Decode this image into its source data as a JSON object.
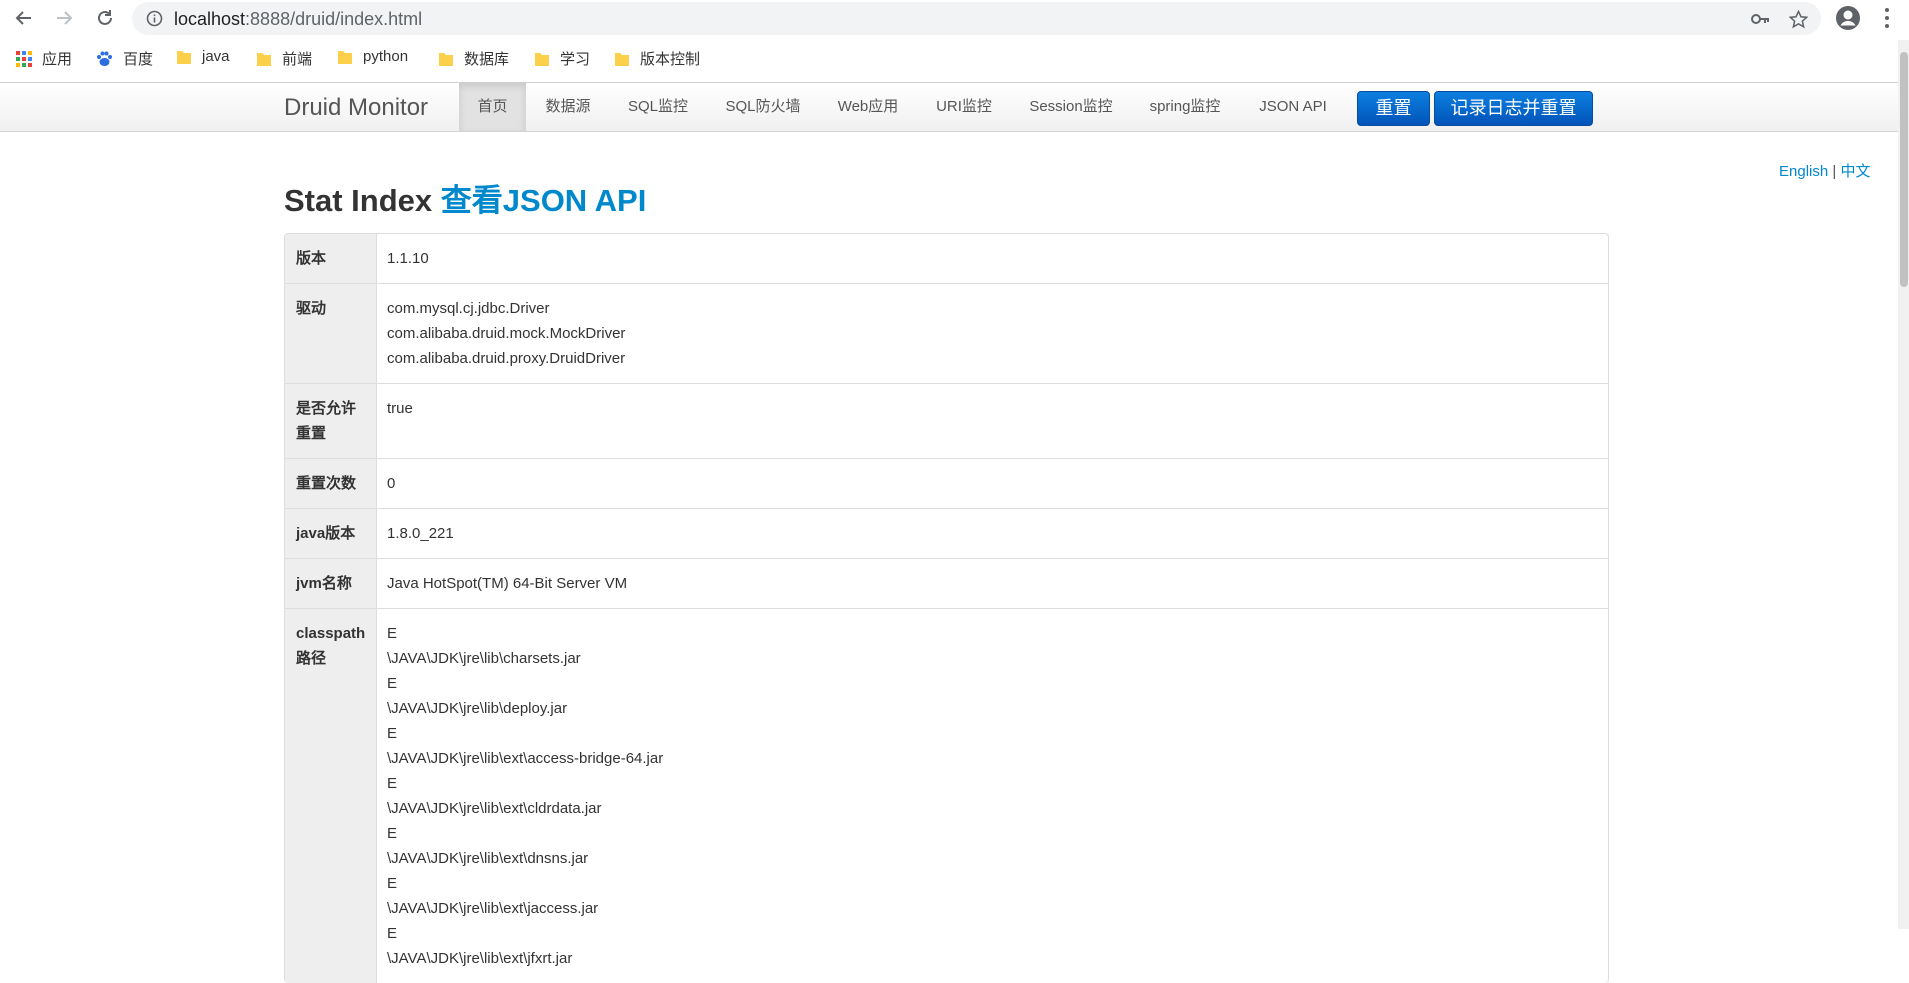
{
  "browser": {
    "url_host": "localhost",
    "url_rest": ":8888/druid/index.html",
    "bookmarks": [
      {
        "label": "应用",
        "icon": "apps-grid-icon"
      },
      {
        "label": "百度",
        "icon": "baidu-paw-icon"
      },
      {
        "label": "java",
        "icon": "folder-icon"
      },
      {
        "label": "前端",
        "icon": "folder-icon"
      },
      {
        "label": "python",
        "icon": "folder-icon"
      },
      {
        "label": "数据库",
        "icon": "folder-icon"
      },
      {
        "label": "学习",
        "icon": "folder-icon"
      },
      {
        "label": "版本控制",
        "icon": "folder-icon"
      }
    ]
  },
  "navbar": {
    "brand": "Druid Monitor",
    "items": [
      "首页",
      "数据源",
      "SQL监控",
      "SQL防火墙",
      "Web应用",
      "URI监控",
      "Session监控",
      "spring监控",
      "JSON API"
    ],
    "active_index": 0,
    "reset_button": "重置",
    "log_reset_button": "记录日志并重置",
    "button_color": "#0461c8"
  },
  "lang": {
    "english": "English",
    "separator": "|",
    "chinese": "中文"
  },
  "page": {
    "title": "Stat Index",
    "title_link": "查看JSON API",
    "link_color": "#0088cc"
  },
  "stats": [
    {
      "label": "版本",
      "values": [
        "1.1.10"
      ]
    },
    {
      "label": "驱动",
      "values": [
        "com.mysql.cj.jdbc.Driver",
        "com.alibaba.druid.mock.MockDriver",
        "com.alibaba.druid.proxy.DruidDriver"
      ]
    },
    {
      "label": "是否允许重置",
      "values": [
        "true"
      ]
    },
    {
      "label": "重置次数",
      "values": [
        "0"
      ]
    },
    {
      "label": "java版本",
      "values": [
        "1.8.0_221"
      ]
    },
    {
      "label": "jvm名称",
      "values": [
        "Java HotSpot(TM) 64-Bit Server VM"
      ]
    },
    {
      "label": "classpath路径",
      "values": [
        "E",
        "\\JAVA\\JDK\\jre\\lib\\charsets.jar",
        "E",
        "\\JAVA\\JDK\\jre\\lib\\deploy.jar",
        "E",
        "\\JAVA\\JDK\\jre\\lib\\ext\\access-bridge-64.jar",
        "E",
        "\\JAVA\\JDK\\jre\\lib\\ext\\cldrdata.jar",
        "E",
        "\\JAVA\\JDK\\jre\\lib\\ext\\dnsns.jar",
        "E",
        "\\JAVA\\JDK\\jre\\lib\\ext\\jaccess.jar",
        "E",
        "\\JAVA\\JDK\\jre\\lib\\ext\\jfxrt.jar"
      ]
    }
  ]
}
